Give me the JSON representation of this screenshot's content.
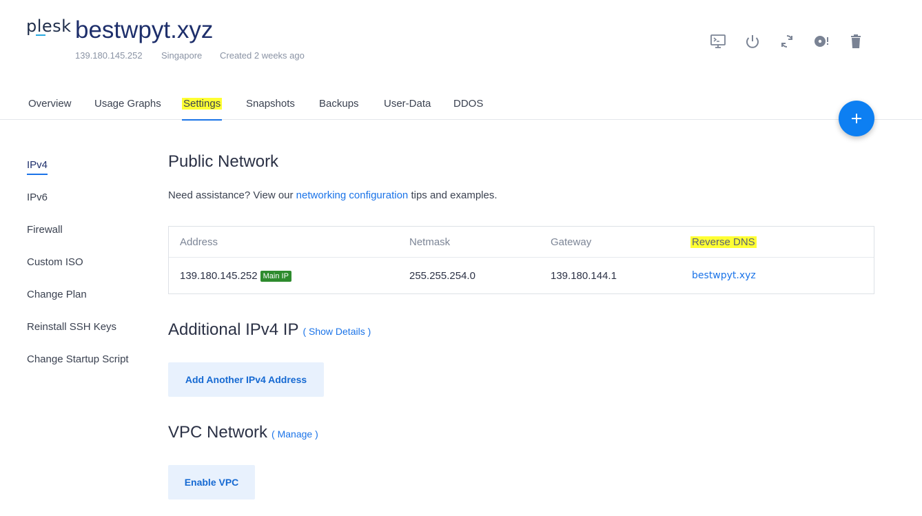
{
  "header": {
    "logo_text": "plesk",
    "title": "bestwpyt.xyz",
    "ip": "139.180.145.252",
    "location": "Singapore",
    "created": "Created 2 weeks ago",
    "actions": [
      "console-icon",
      "power-icon",
      "restart-icon",
      "disc-icon",
      "trash-icon"
    ]
  },
  "tabs": [
    {
      "label": "Overview",
      "active": false
    },
    {
      "label": "Usage Graphs",
      "active": false
    },
    {
      "label": "Settings",
      "active": true
    },
    {
      "label": "Snapshots",
      "active": false
    },
    {
      "label": "Backups",
      "active": false
    },
    {
      "label": "User-Data",
      "active": false
    },
    {
      "label": "DDOS",
      "active": false
    }
  ],
  "fab": {
    "icon": "plus-icon"
  },
  "sidebar": {
    "items": [
      {
        "label": "IPv4",
        "active": true
      },
      {
        "label": "IPv6",
        "active": false
      },
      {
        "label": "Firewall",
        "active": false
      },
      {
        "label": "Custom ISO",
        "active": false
      },
      {
        "label": "Change Plan",
        "active": false
      },
      {
        "label": "Reinstall SSH Keys",
        "active": false
      },
      {
        "label": "Change Startup Script",
        "active": false
      }
    ]
  },
  "public_network": {
    "title": "Public Network",
    "assist_prefix": "Need assistance? View our ",
    "assist_link": "networking configuration",
    "assist_suffix": " tips and examples.",
    "table": {
      "headers": [
        "Address",
        "Netmask",
        "Gateway",
        "Reverse DNS"
      ],
      "row": {
        "address": "139.180.145.252",
        "badge": "Main IP",
        "netmask": "255.255.254.0",
        "gateway": "139.180.144.1",
        "reverse_dns": "bestwpyt.xyz"
      }
    }
  },
  "additional_ipv4": {
    "title": "Additional IPv4 IP",
    "link": "( Show Details )",
    "button": "Add Another IPv4 Address"
  },
  "vpc": {
    "title": "VPC Network",
    "link": "( Manage )",
    "button": "Enable VPC"
  },
  "colors": {
    "accent": "#1a73e8",
    "fab": "#0d7ff2",
    "highlight": "#ffff33",
    "badge": "#2e8b2e",
    "title": "#1e2f6b"
  }
}
